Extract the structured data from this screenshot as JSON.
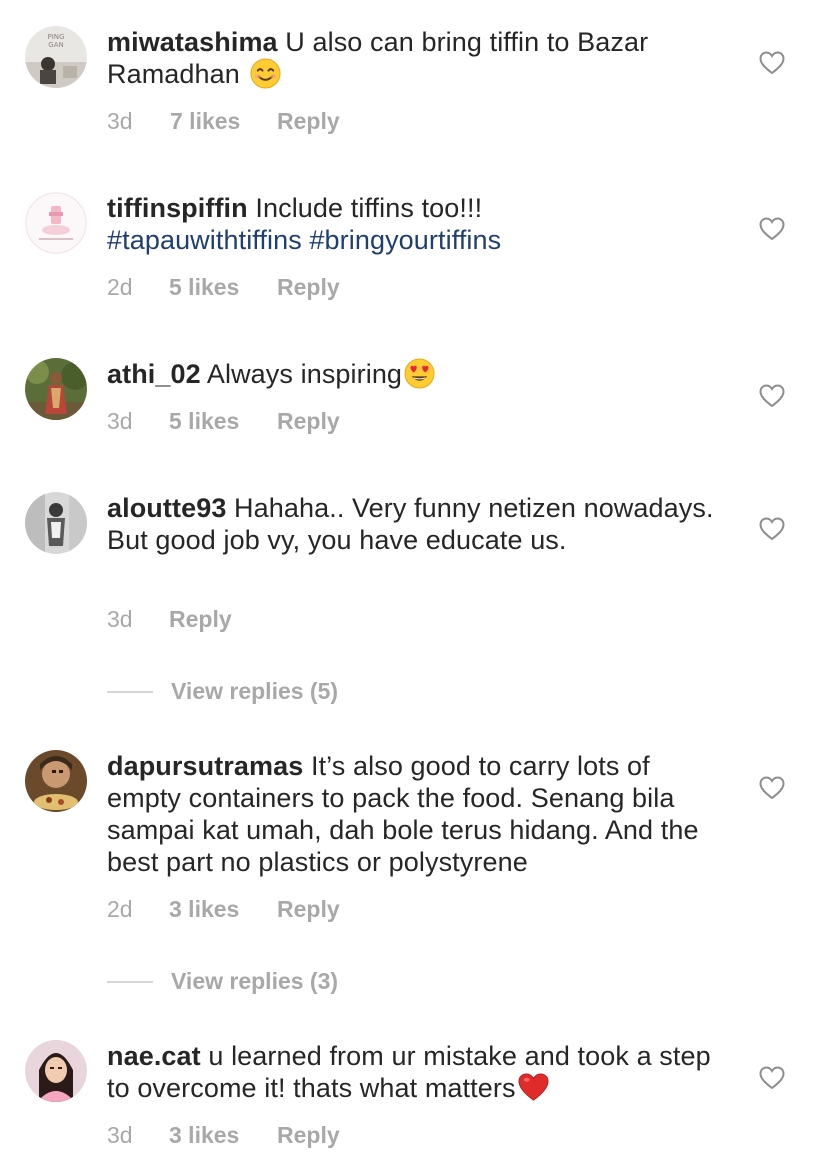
{
  "comments": [
    {
      "username": "miwatashima",
      "text": "U also can bring tiffin to Bazar Ramadhan",
      "emoji": "smiling-face-emoji",
      "time": "3d",
      "likes": "7 likes",
      "reply": "Reply"
    },
    {
      "username": "tiffinspiffin",
      "text": "Include tiffins too!!!",
      "hashtags": "#tapauwithtiffins #bringyourtiffins",
      "time": "2d",
      "likes": "5 likes",
      "reply": "Reply"
    },
    {
      "username": "athi_02",
      "text": "Always inspiring",
      "emoji": "heart-eyes-emoji",
      "time": "3d",
      "likes": "5 likes",
      "reply": "Reply"
    },
    {
      "username": "aloutte93",
      "text": "Hahaha.. Very funny netizen nowadays.  But good job vy,  you have educate us.",
      "time": "3d",
      "reply": "Reply",
      "view_replies": "View replies (5)"
    },
    {
      "username": "dapursutramas",
      "text": "It’s also good to carry lots of empty containers to pack the food. Senang bila sampai kat umah, dah bole terus hidang. And the best part no plastics or polystyrene",
      "time": "2d",
      "likes": "3 likes",
      "reply": "Reply",
      "view_replies": "View replies (3)"
    },
    {
      "username": "nae.cat",
      "text": "u learned from ur mistake and took a step to overcome it! thats what matters",
      "emoji": "red-heart-emoji",
      "time": "3d",
      "likes": "3 likes",
      "reply": "Reply"
    }
  ],
  "colors": {
    "text": "#262626",
    "meta": "#a8a8a8",
    "hashtag": "#1e3f6f",
    "divider": "#d6d6d6"
  },
  "icons": {
    "like": "heart-outline-icon"
  }
}
